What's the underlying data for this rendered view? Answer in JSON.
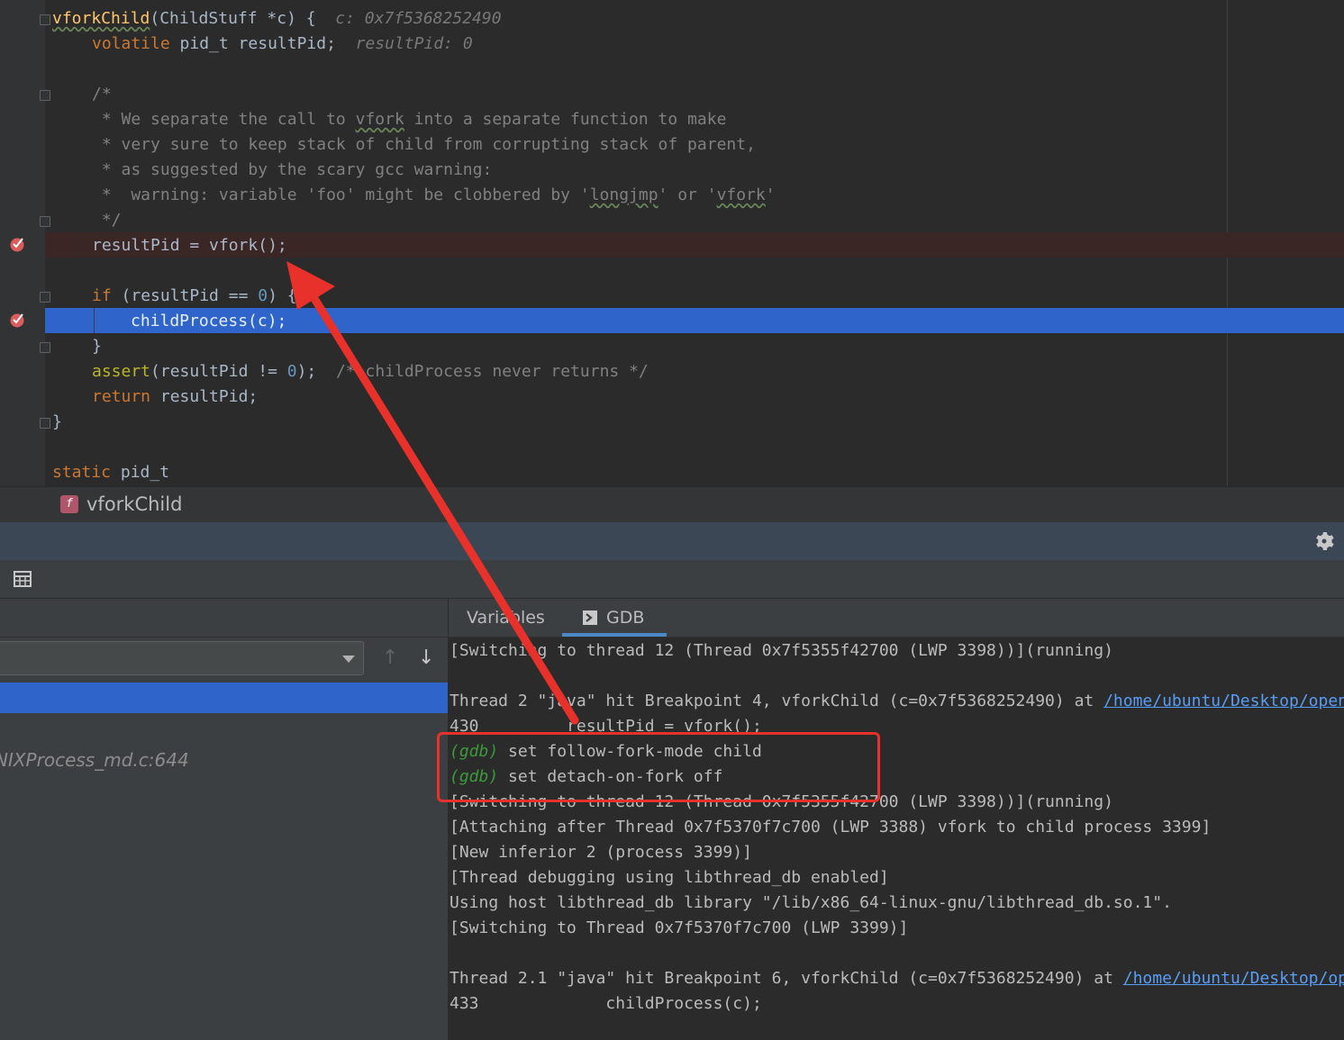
{
  "editor": {
    "lines": {
      "l0_fn": "vforkChild",
      "l0_rest": "(ChildStuff *c) {",
      "l0_hint": "c: 0x7f5368252490",
      "l1_kw": "volatile",
      "l1_rest": " pid_t resultPid;",
      "l1_hint": "resultPid: 0",
      "c0": "/*",
      "c1a": " * We separate the call to ",
      "c1b": "vfork",
      "c1c": " into a separate function to make",
      "c2": " * very sure to keep stack of child from corrupting stack of parent,",
      "c3": " * as suggested by the scary gcc warning:",
      "c4a": " *  warning: variable 'foo' might be clobbered by '",
      "c4b": "longjmp",
      "c4c": "' or '",
      "c4d": "vfork",
      "c4e": "'",
      "c5": " */",
      "bp_line": "resultPid = vfork();",
      "if_kw": "if",
      "if_rest": " (resultPid == ",
      "if_num": "0",
      "if_end": ") {",
      "exec_line": "childProcess(c);",
      "close_brace": "}",
      "assert_fn": "assert",
      "assert_rest": "(resultPid != ",
      "assert_num": "0",
      "assert_end": ");",
      "assert_cm": "/* childProcess never returns */",
      "return_kw": "return",
      "return_rest": " resultPid;",
      "fn_close": "}",
      "static_kw": "static",
      "static_rest": " pid_t"
    }
  },
  "breadcrumb": {
    "icon_letter": "f",
    "label": "vforkChild"
  },
  "frames": {
    "frame_2": "NIXProcess_md.c:644"
  },
  "tabs": {
    "variables": "Variables",
    "gdb": "GDB"
  },
  "console": {
    "l1": "[Switching to thread 12 (Thread 0x7f5355f42700 (LWP 3398))](running)",
    "l2a": "Thread 2 \"java\" hit Breakpoint 4, vforkChild (c=0x7f5368252490) at ",
    "l2b": "/home/ubuntu/Desktop/open",
    "l3": "430         resultPid = vfork();",
    "prompt": "(gdb)",
    "cmd1": " set follow-fork-mode child",
    "cmd2": " set detach-on-fork off",
    "l6": "[Switching to thread 12 (Thread 0x7f5355f42700 (LWP 3398))](running)",
    "l7": "[Attaching after Thread 0x7f5370f7c700 (LWP 3388) vfork to child process 3399]",
    "l8": "[New inferior 2 (process 3399)]",
    "l9": "[Thread debugging using libthread_db enabled]",
    "l10": "Using host libthread_db library \"/lib/x86_64-linux-gnu/libthread_db.so.1\".",
    "l11": "[Switching to Thread 0x7f5370f7c700 (LWP 3399)]",
    "l12a": "Thread 2.1 \"java\" hit Breakpoint 6, vforkChild (c=0x7f5368252490) at ",
    "l12b": "/home/ubuntu/Desktop/op",
    "l13": "433             childProcess(c);"
  },
  "colors": {
    "annotation": "#e8312a",
    "exec_highlight": "#2f65ca",
    "breakpoint": "#db5c5c"
  }
}
